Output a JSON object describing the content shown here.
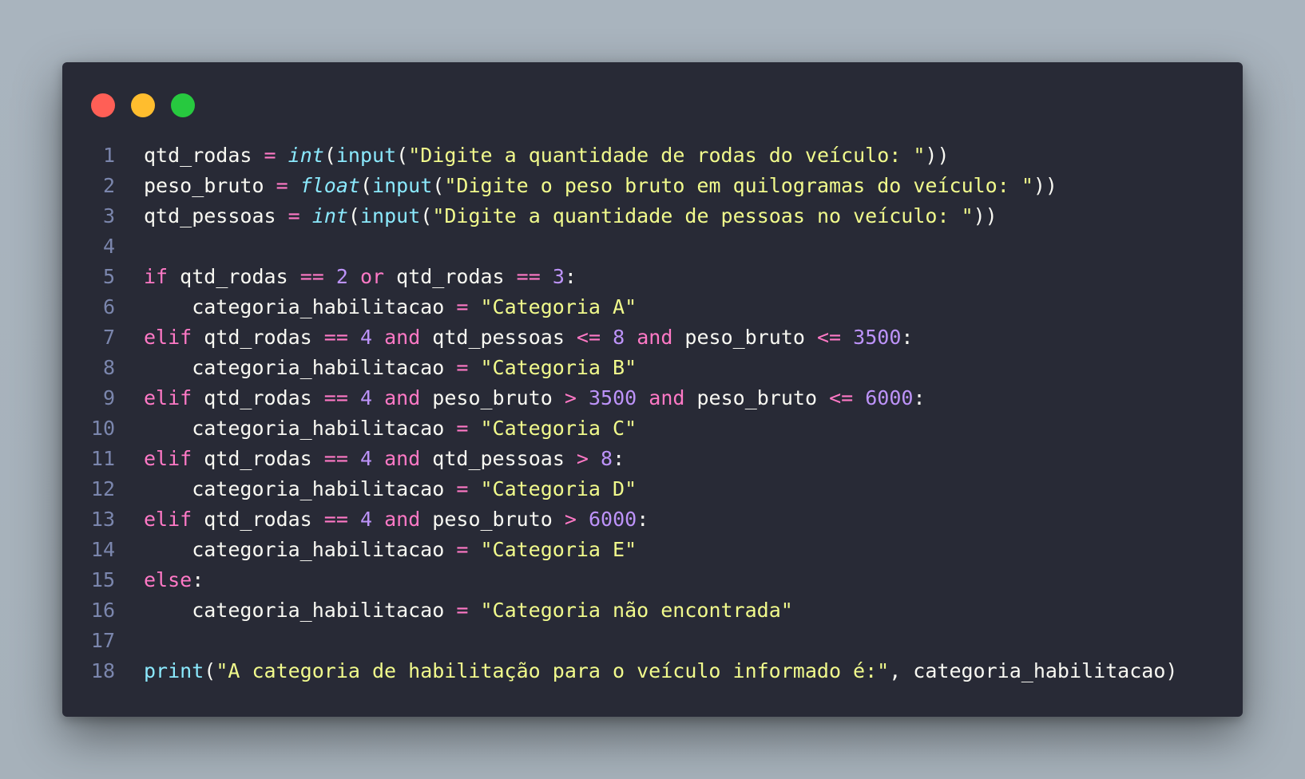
{
  "window": {
    "dots": [
      {
        "name": "close",
        "color": "#ff5f56"
      },
      {
        "name": "minimize",
        "color": "#ffbd2e"
      },
      {
        "name": "maximize",
        "color": "#27c93f"
      }
    ]
  },
  "code": {
    "lines": [
      {
        "n": "1",
        "tokens": [
          {
            "t": "qtd_rodas",
            "k": "id"
          },
          {
            "t": " ",
            "k": "p"
          },
          {
            "t": "=",
            "k": "op"
          },
          {
            "t": " ",
            "k": "p"
          },
          {
            "t": "int",
            "k": "type"
          },
          {
            "t": "(",
            "k": "p"
          },
          {
            "t": "input",
            "k": "fn"
          },
          {
            "t": "(",
            "k": "p"
          },
          {
            "t": "\"Digite a quantidade de rodas do veículo: \"",
            "k": "str"
          },
          {
            "t": "))",
            "k": "p"
          }
        ]
      },
      {
        "n": "2",
        "tokens": [
          {
            "t": "peso_bruto",
            "k": "id"
          },
          {
            "t": " ",
            "k": "p"
          },
          {
            "t": "=",
            "k": "op"
          },
          {
            "t": " ",
            "k": "p"
          },
          {
            "t": "float",
            "k": "type"
          },
          {
            "t": "(",
            "k": "p"
          },
          {
            "t": "input",
            "k": "fn"
          },
          {
            "t": "(",
            "k": "p"
          },
          {
            "t": "\"Digite o peso bruto em quilogramas do veículo: \"",
            "k": "str"
          },
          {
            "t": "))",
            "k": "p"
          }
        ]
      },
      {
        "n": "3",
        "tokens": [
          {
            "t": "qtd_pessoas",
            "k": "id"
          },
          {
            "t": " ",
            "k": "p"
          },
          {
            "t": "=",
            "k": "op"
          },
          {
            "t": " ",
            "k": "p"
          },
          {
            "t": "int",
            "k": "type"
          },
          {
            "t": "(",
            "k": "p"
          },
          {
            "t": "input",
            "k": "fn"
          },
          {
            "t": "(",
            "k": "p"
          },
          {
            "t": "\"Digite a quantidade de pessoas no veículo: \"",
            "k": "str"
          },
          {
            "t": "))",
            "k": "p"
          }
        ]
      },
      {
        "n": "4",
        "tokens": []
      },
      {
        "n": "5",
        "tokens": [
          {
            "t": "if",
            "k": "kw"
          },
          {
            "t": " qtd_rodas ",
            "k": "id"
          },
          {
            "t": "==",
            "k": "op"
          },
          {
            "t": " ",
            "k": "p"
          },
          {
            "t": "2",
            "k": "num"
          },
          {
            "t": " ",
            "k": "p"
          },
          {
            "t": "or",
            "k": "kw"
          },
          {
            "t": " qtd_rodas ",
            "k": "id"
          },
          {
            "t": "==",
            "k": "op"
          },
          {
            "t": " ",
            "k": "p"
          },
          {
            "t": "3",
            "k": "num"
          },
          {
            "t": ":",
            "k": "p"
          }
        ]
      },
      {
        "n": "6",
        "tokens": [
          {
            "t": "    categoria_habilitacao ",
            "k": "id"
          },
          {
            "t": "=",
            "k": "op"
          },
          {
            "t": " ",
            "k": "p"
          },
          {
            "t": "\"Categoria A\"",
            "k": "str"
          }
        ]
      },
      {
        "n": "7",
        "tokens": [
          {
            "t": "elif",
            "k": "kw"
          },
          {
            "t": " qtd_rodas ",
            "k": "id"
          },
          {
            "t": "==",
            "k": "op"
          },
          {
            "t": " ",
            "k": "p"
          },
          {
            "t": "4",
            "k": "num"
          },
          {
            "t": " ",
            "k": "p"
          },
          {
            "t": "and",
            "k": "kw"
          },
          {
            "t": " qtd_pessoas ",
            "k": "id"
          },
          {
            "t": "<=",
            "k": "op"
          },
          {
            "t": " ",
            "k": "p"
          },
          {
            "t": "8",
            "k": "num"
          },
          {
            "t": " ",
            "k": "p"
          },
          {
            "t": "and",
            "k": "kw"
          },
          {
            "t": " peso_bruto ",
            "k": "id"
          },
          {
            "t": "<=",
            "k": "op"
          },
          {
            "t": " ",
            "k": "p"
          },
          {
            "t": "3500",
            "k": "num"
          },
          {
            "t": ":",
            "k": "p"
          }
        ]
      },
      {
        "n": "8",
        "tokens": [
          {
            "t": "    categoria_habilitacao ",
            "k": "id"
          },
          {
            "t": "=",
            "k": "op"
          },
          {
            "t": " ",
            "k": "p"
          },
          {
            "t": "\"Categoria B\"",
            "k": "str"
          }
        ]
      },
      {
        "n": "9",
        "tokens": [
          {
            "t": "elif",
            "k": "kw"
          },
          {
            "t": " qtd_rodas ",
            "k": "id"
          },
          {
            "t": "==",
            "k": "op"
          },
          {
            "t": " ",
            "k": "p"
          },
          {
            "t": "4",
            "k": "num"
          },
          {
            "t": " ",
            "k": "p"
          },
          {
            "t": "and",
            "k": "kw"
          },
          {
            "t": " peso_bruto ",
            "k": "id"
          },
          {
            "t": ">",
            "k": "op"
          },
          {
            "t": " ",
            "k": "p"
          },
          {
            "t": "3500",
            "k": "num"
          },
          {
            "t": " ",
            "k": "p"
          },
          {
            "t": "and",
            "k": "kw"
          },
          {
            "t": " peso_bruto ",
            "k": "id"
          },
          {
            "t": "<=",
            "k": "op"
          },
          {
            "t": " ",
            "k": "p"
          },
          {
            "t": "6000",
            "k": "num"
          },
          {
            "t": ":",
            "k": "p"
          }
        ]
      },
      {
        "n": "10",
        "tokens": [
          {
            "t": "    categoria_habilitacao ",
            "k": "id"
          },
          {
            "t": "=",
            "k": "op"
          },
          {
            "t": " ",
            "k": "p"
          },
          {
            "t": "\"Categoria C\"",
            "k": "str"
          }
        ]
      },
      {
        "n": "11",
        "tokens": [
          {
            "t": "elif",
            "k": "kw"
          },
          {
            "t": " qtd_rodas ",
            "k": "id"
          },
          {
            "t": "==",
            "k": "op"
          },
          {
            "t": " ",
            "k": "p"
          },
          {
            "t": "4",
            "k": "num"
          },
          {
            "t": " ",
            "k": "p"
          },
          {
            "t": "and",
            "k": "kw"
          },
          {
            "t": " qtd_pessoas ",
            "k": "id"
          },
          {
            "t": ">",
            "k": "op"
          },
          {
            "t": " ",
            "k": "p"
          },
          {
            "t": "8",
            "k": "num"
          },
          {
            "t": ":",
            "k": "p"
          }
        ]
      },
      {
        "n": "12",
        "tokens": [
          {
            "t": "    categoria_habilitacao ",
            "k": "id"
          },
          {
            "t": "=",
            "k": "op"
          },
          {
            "t": " ",
            "k": "p"
          },
          {
            "t": "\"Categoria D\"",
            "k": "str"
          }
        ]
      },
      {
        "n": "13",
        "tokens": [
          {
            "t": "elif",
            "k": "kw"
          },
          {
            "t": " qtd_rodas ",
            "k": "id"
          },
          {
            "t": "==",
            "k": "op"
          },
          {
            "t": " ",
            "k": "p"
          },
          {
            "t": "4",
            "k": "num"
          },
          {
            "t": " ",
            "k": "p"
          },
          {
            "t": "and",
            "k": "kw"
          },
          {
            "t": " peso_bruto ",
            "k": "id"
          },
          {
            "t": ">",
            "k": "op"
          },
          {
            "t": " ",
            "k": "p"
          },
          {
            "t": "6000",
            "k": "num"
          },
          {
            "t": ":",
            "k": "p"
          }
        ]
      },
      {
        "n": "14",
        "tokens": [
          {
            "t": "    categoria_habilitacao ",
            "k": "id"
          },
          {
            "t": "=",
            "k": "op"
          },
          {
            "t": " ",
            "k": "p"
          },
          {
            "t": "\"Categoria E\"",
            "k": "str"
          }
        ]
      },
      {
        "n": "15",
        "tokens": [
          {
            "t": "else",
            "k": "kw"
          },
          {
            "t": ":",
            "k": "p"
          }
        ]
      },
      {
        "n": "16",
        "tokens": [
          {
            "t": "    categoria_habilitacao ",
            "k": "id"
          },
          {
            "t": "=",
            "k": "op"
          },
          {
            "t": " ",
            "k": "p"
          },
          {
            "t": "\"Categoria não encontrada\"",
            "k": "str"
          }
        ]
      },
      {
        "n": "17",
        "tokens": []
      },
      {
        "n": "18",
        "tokens": [
          {
            "t": "print",
            "k": "fn"
          },
          {
            "t": "(",
            "k": "p"
          },
          {
            "t": "\"A categoria de habilitação para o veículo informado é:\"",
            "k": "str"
          },
          {
            "t": ", categoria_habilitacao)",
            "k": "p"
          }
        ]
      }
    ]
  }
}
